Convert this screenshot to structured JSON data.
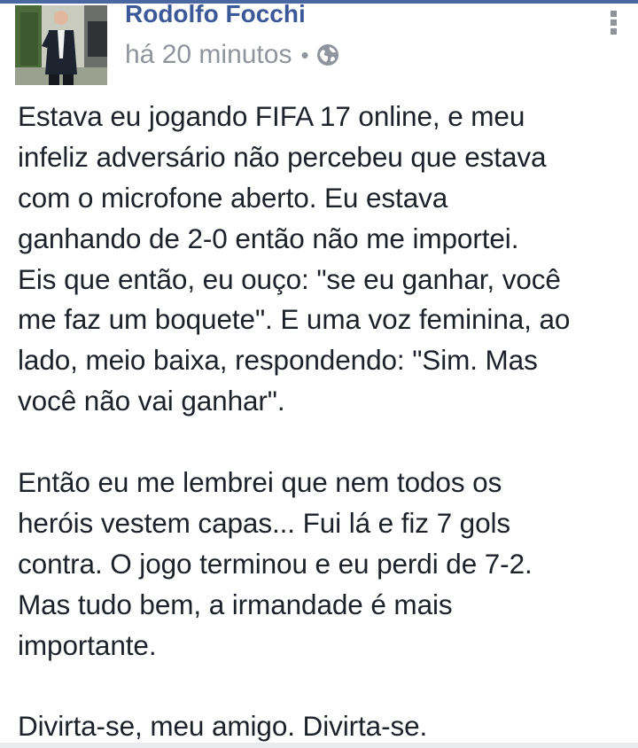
{
  "post": {
    "author": "Rodolfo Focchi",
    "timestamp": "há 20 minutos",
    "separator": "•",
    "privacy_icon": "globe-icon",
    "menu_icon": "more-vertical-icon",
    "avatar_icon": "user-photo",
    "text_lines": [
      "Estava eu jogando FIFA 17 online, e meu",
      "infeliz adversário não percebeu que estava",
      "com o microfone aberto. Eu estava",
      "ganhando de 2-0 então não me importei.",
      "Eis que então, eu ouço: \"se eu ganhar, você",
      "me faz um boquete\". E uma voz feminina, ao",
      "lado, meio baixa, respondendo: \"Sim. Mas",
      "você não vai ganhar\".",
      "",
      "Então eu me lembrei que nem todos os",
      "heróis vestem capas... Fui lá e fiz 7 gols",
      "contra. O jogo terminou e eu perdi de 7-2.",
      "Mas tudo bem, a irmandade é mais",
      "importante.",
      "",
      "Divirta-se, meu amigo. Divirta-se."
    ]
  },
  "colors": {
    "author": "#3b5998",
    "meta": "#90949c",
    "body_text": "#1d2129",
    "top_bar": "#4b67a1"
  }
}
